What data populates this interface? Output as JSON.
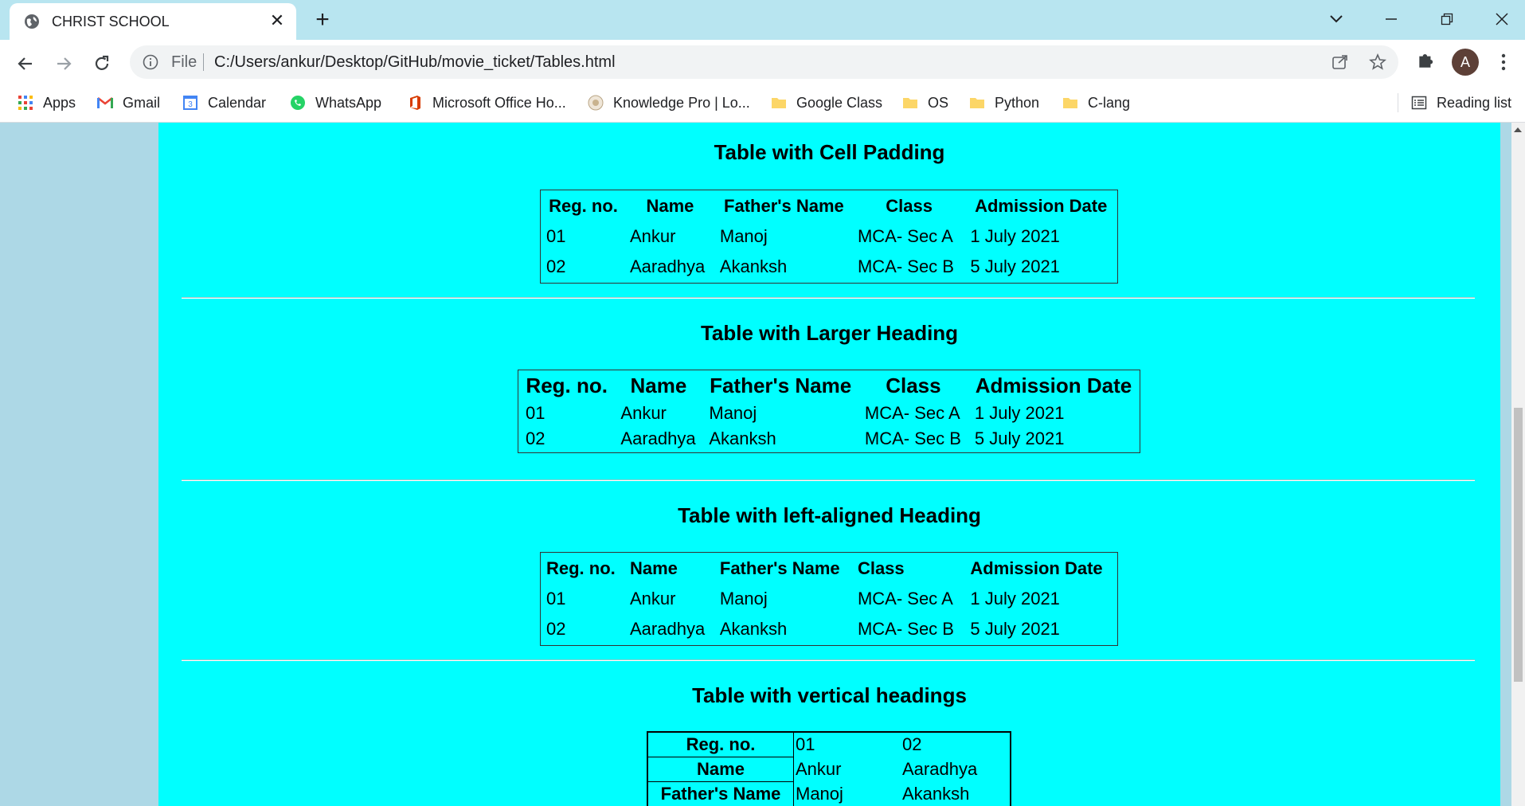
{
  "browser": {
    "tab_title": "CHRIST SCHOOL",
    "url_scheme_label": "File",
    "url": "C:/Users/ankur/Desktop/GitHub/movie_ticket/Tables.html",
    "profile_initial": "A"
  },
  "bookmarks": {
    "items": [
      {
        "label": "Apps",
        "icon": "apps-grid-icon"
      },
      {
        "label": "Gmail",
        "icon": "gmail-icon"
      },
      {
        "label": "Calendar",
        "icon": "calendar-icon"
      },
      {
        "label": "WhatsApp",
        "icon": "whatsapp-icon"
      },
      {
        "label": "Microsoft Office Ho...",
        "icon": "office-icon"
      },
      {
        "label": "Knowledge Pro | Lo...",
        "icon": "knowledge-pro-icon"
      },
      {
        "label": "Google Class",
        "icon": "folder-icon"
      },
      {
        "label": "OS",
        "icon": "folder-icon"
      },
      {
        "label": "Python",
        "icon": "folder-icon"
      },
      {
        "label": "C-lang",
        "icon": "folder-icon"
      }
    ],
    "reading_list": "Reading list"
  },
  "page": {
    "headers": [
      "Reg. no.",
      "Name",
      "Father's Name",
      "Class",
      "Admission Date"
    ],
    "rows": [
      [
        "01",
        "Ankur",
        "Manoj",
        "MCA- Sec A",
        "1 July 2021"
      ],
      [
        "02",
        "Aaradhya",
        "Akanksh",
        "MCA- Sec B",
        "5 July 2021"
      ]
    ],
    "sections": [
      {
        "title": "Table with Cell Padding"
      },
      {
        "title": "Table with Larger Heading"
      },
      {
        "title": "Table with left-aligned Heading"
      },
      {
        "title": "Table with vertical headings"
      }
    ]
  },
  "colors": {
    "page_background": "#add8e6",
    "content_background": "#00ffff",
    "tabbar_background": "#b8e5f0"
  }
}
